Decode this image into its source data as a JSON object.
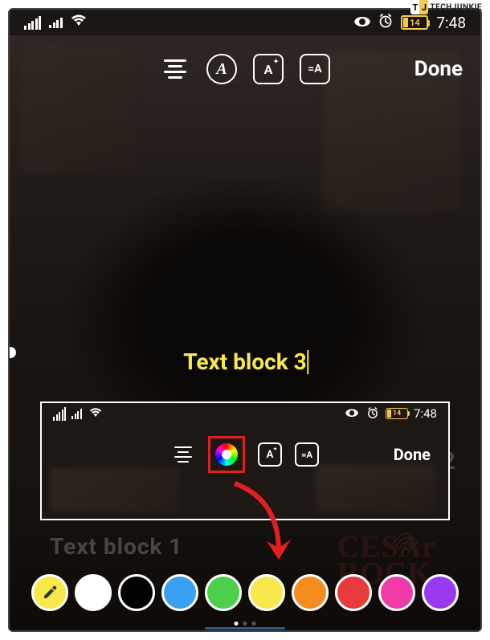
{
  "watermark": {
    "text": "TECHJUNKIE",
    "logo_t": "T",
    "logo_j": "J"
  },
  "statusbar": {
    "battery_level": "14",
    "clock": "7:48"
  },
  "toolbar": {
    "font_label": "A",
    "effect_label": "A",
    "bg_label": "=A",
    "done_label": "Done"
  },
  "text_blocks": {
    "tb1": "Text block 1",
    "tb2": "ck 2",
    "tb3": "Text block 3"
  },
  "inset": {
    "battery_level": "14",
    "clock": "7:48",
    "effect_label": "A",
    "bg_label": "=A",
    "done_label": "Done"
  },
  "cesar": {
    "line1": "CESAr",
    "line2": "ROCK"
  },
  "palette": {
    "colors": [
      "#f7e94a",
      "#ffffff",
      "#000000",
      "#3aa0f0",
      "#4cd04c",
      "#f7e94a",
      "#f78c1e",
      "#e83a3a",
      "#f03aa8",
      "#9a3af0"
    ]
  }
}
